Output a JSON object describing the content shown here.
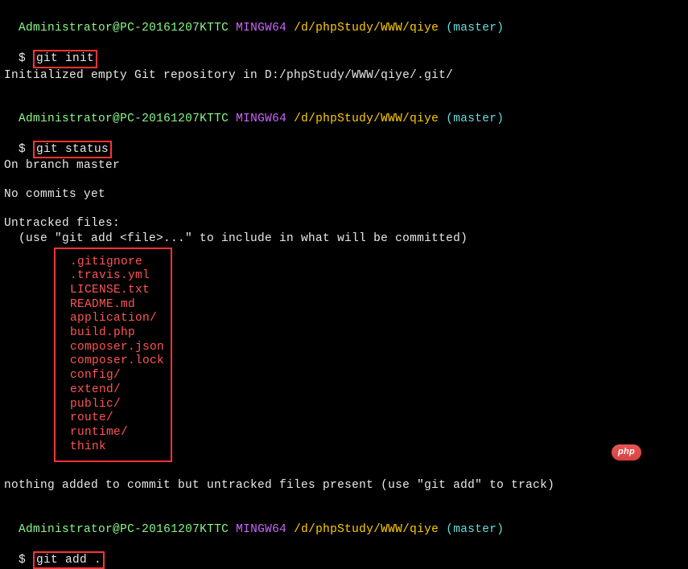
{
  "prompts": [
    {
      "user": "Administrator",
      "at": "@",
      "host": "PC-20161207KTTC",
      "env": "MINGW64",
      "path": "/d/phpStudy/WWW/qiye",
      "branch": "(master)",
      "dollar": "$ ",
      "command": "git init"
    },
    {
      "user": "Administrator",
      "at": "@",
      "host": "PC-20161207KTTC",
      "env": "MINGW64",
      "path": "/d/phpStudy/WWW/qiye",
      "branch": "(master)",
      "dollar": "$ ",
      "command": "git status"
    },
    {
      "user": "Administrator",
      "at": "@",
      "host": "PC-20161207KTTC",
      "env": "MINGW64",
      "path": "/d/phpStudy/WWW/qiye",
      "branch": "(master)",
      "dollar": "$ ",
      "command": "git add ."
    }
  ],
  "output": {
    "init_result": "Initialized empty Git repository in D:/phpStudy/WWW/qiye/.git/",
    "on_branch": "On branch master",
    "no_commits": "No commits yet",
    "untracked_header": "Untracked files:",
    "untracked_hint": "  (use \"git add <file>...\" to include in what will be committed)",
    "nothing_added": "nothing added to commit but untracked files present (use \"git add\" to track)"
  },
  "files": [
    ".gitignore",
    ".travis.yml",
    "LICENSE.txt",
    "README.md",
    "application/",
    "build.php",
    "composer.json",
    "composer.lock",
    "config/",
    "extend/",
    "public/",
    "route/",
    "runtime/",
    "think"
  ],
  "badge": {
    "label": "php"
  }
}
